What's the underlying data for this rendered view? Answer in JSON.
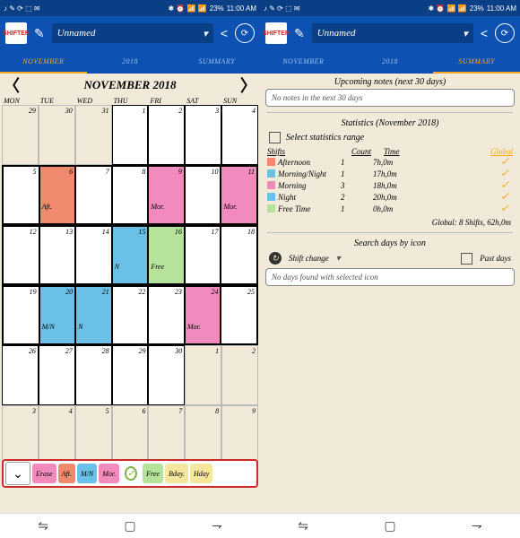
{
  "status": {
    "time": "11:00 AM",
    "battery": "23%",
    "left_icons": "♪ ✎ ⟳ ⬚ ✉",
    "right_icons": "✱ ⏰ 📶 📶"
  },
  "appbar": {
    "icon_label": "SHIFTER",
    "title": "Unnamed",
    "chev": "▾"
  },
  "tabs": {
    "left": "NOVEMBER",
    "mid": "2018",
    "right": "SUMMARY"
  },
  "cal": {
    "title": "NOVEMBER 2018",
    "dow": [
      "MON",
      "TUE",
      "WED",
      "THU",
      "FRI",
      "SAT",
      "SUN"
    ]
  },
  "shiftbar": {
    "erase": "Erase",
    "aft": "Aft.",
    "mn": "M/N",
    "mor": "Mor.",
    "free": "Free",
    "bday": "Bday.",
    "hday": "Hday"
  },
  "sum": {
    "upcoming_title": "Upcoming notes (next 30 days)",
    "upcoming_empty": "No notes in the next 30 days",
    "stats_title": "Statistics (November 2018)",
    "select_range": "Select statistics range",
    "hdr_shifts": "Shifts",
    "hdr_count": "Count",
    "hdr_time": "Time",
    "hdr_global": "Global",
    "rows": [
      {
        "name": "Afternoon",
        "count": "1",
        "time": "7h,0m",
        "color": "#f08a6e"
      },
      {
        "name": "Morning/Night",
        "count": "1",
        "time": "17h,0m",
        "color": "#6bc0e8"
      },
      {
        "name": "Morning",
        "count": "3",
        "time": "18h,0m",
        "color": "#f28bbd"
      },
      {
        "name": "Night",
        "count": "2",
        "time": "20h,0m",
        "color": "#6bc0e8"
      },
      {
        "name": "Free Time",
        "count": "1",
        "time": "0h,0m",
        "color": "#b5e39b"
      }
    ],
    "global_total": "Global: 8 Shifts, 62h,0m",
    "search_title": "Search days by icon",
    "shift_change": "Shift change",
    "past_days": "Past days",
    "search_empty": "No days found with selected icon"
  }
}
